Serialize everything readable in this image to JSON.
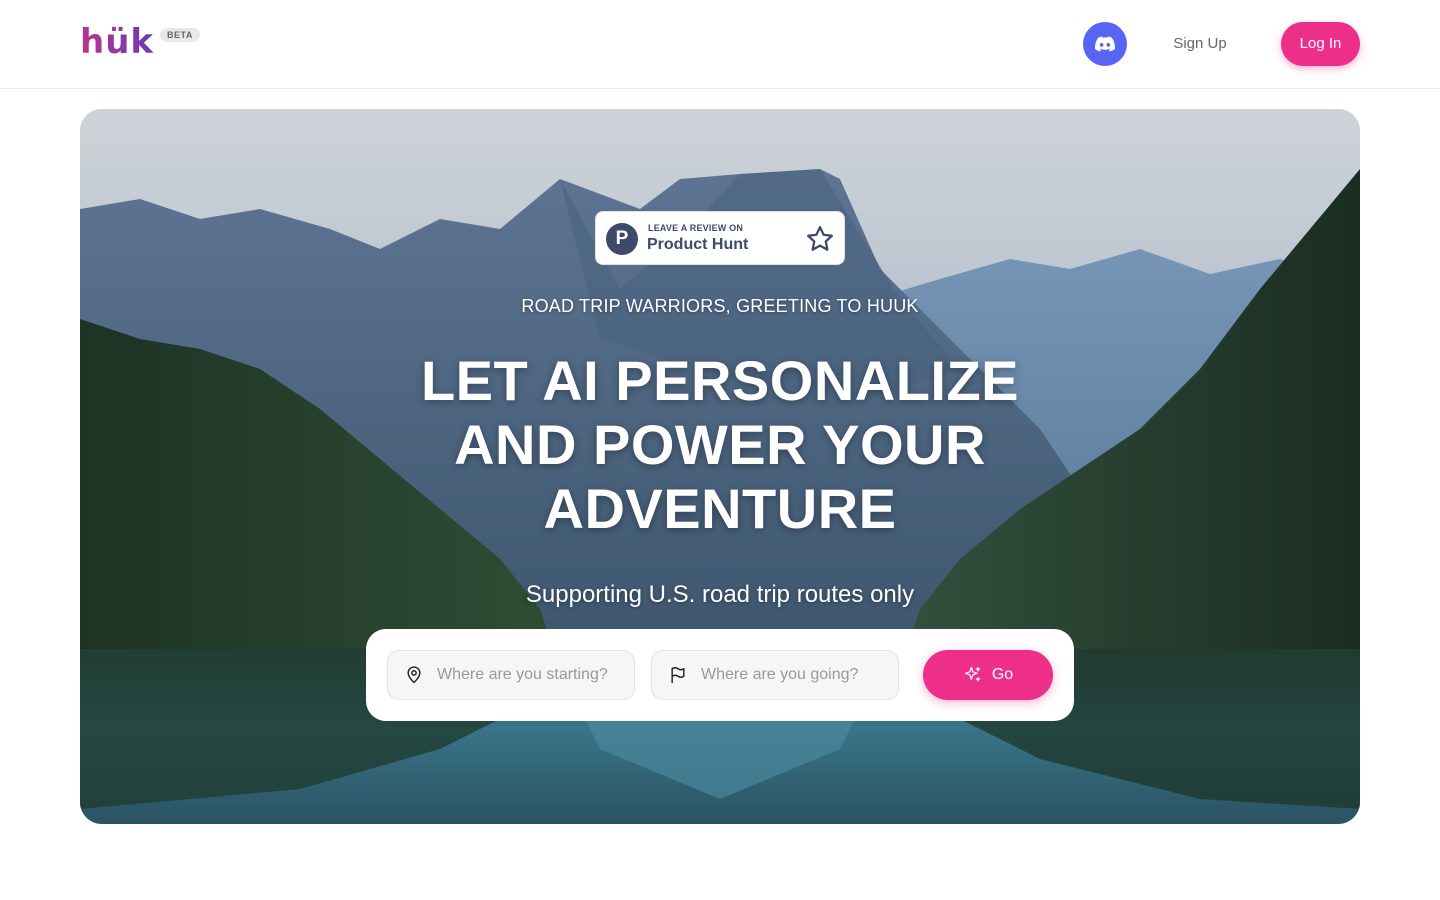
{
  "header": {
    "logo_text": "hük",
    "beta_label": "BETA",
    "discord_icon": "discord-icon",
    "signup_label": "Sign Up",
    "login_label": "Log In"
  },
  "hero": {
    "badge": {
      "small_text": "LEAVE A REVIEW ON",
      "big_text": "Product Hunt",
      "logo_letter": "P",
      "icon": "star-outline-icon"
    },
    "greeting": "ROAD TRIP WARRIORS, GREETING TO HUUK",
    "headline_lines": [
      "LET AI PERSONALIZE",
      "AND POWER YOUR",
      "ADVENTURE"
    ],
    "support_text": "Supporting U.S. road trip routes only",
    "search": {
      "start_placeholder": "Where are you starting?",
      "end_placeholder": "Where are you going?",
      "start_icon": "location-pin-icon",
      "end_icon": "flag-icon",
      "go_label": "Go",
      "go_icon": "sparkles-icon"
    }
  },
  "colors": {
    "brand_pink": "#ee2f8a",
    "discord": "#5865f2",
    "product_hunt": "#3d4a6b"
  }
}
